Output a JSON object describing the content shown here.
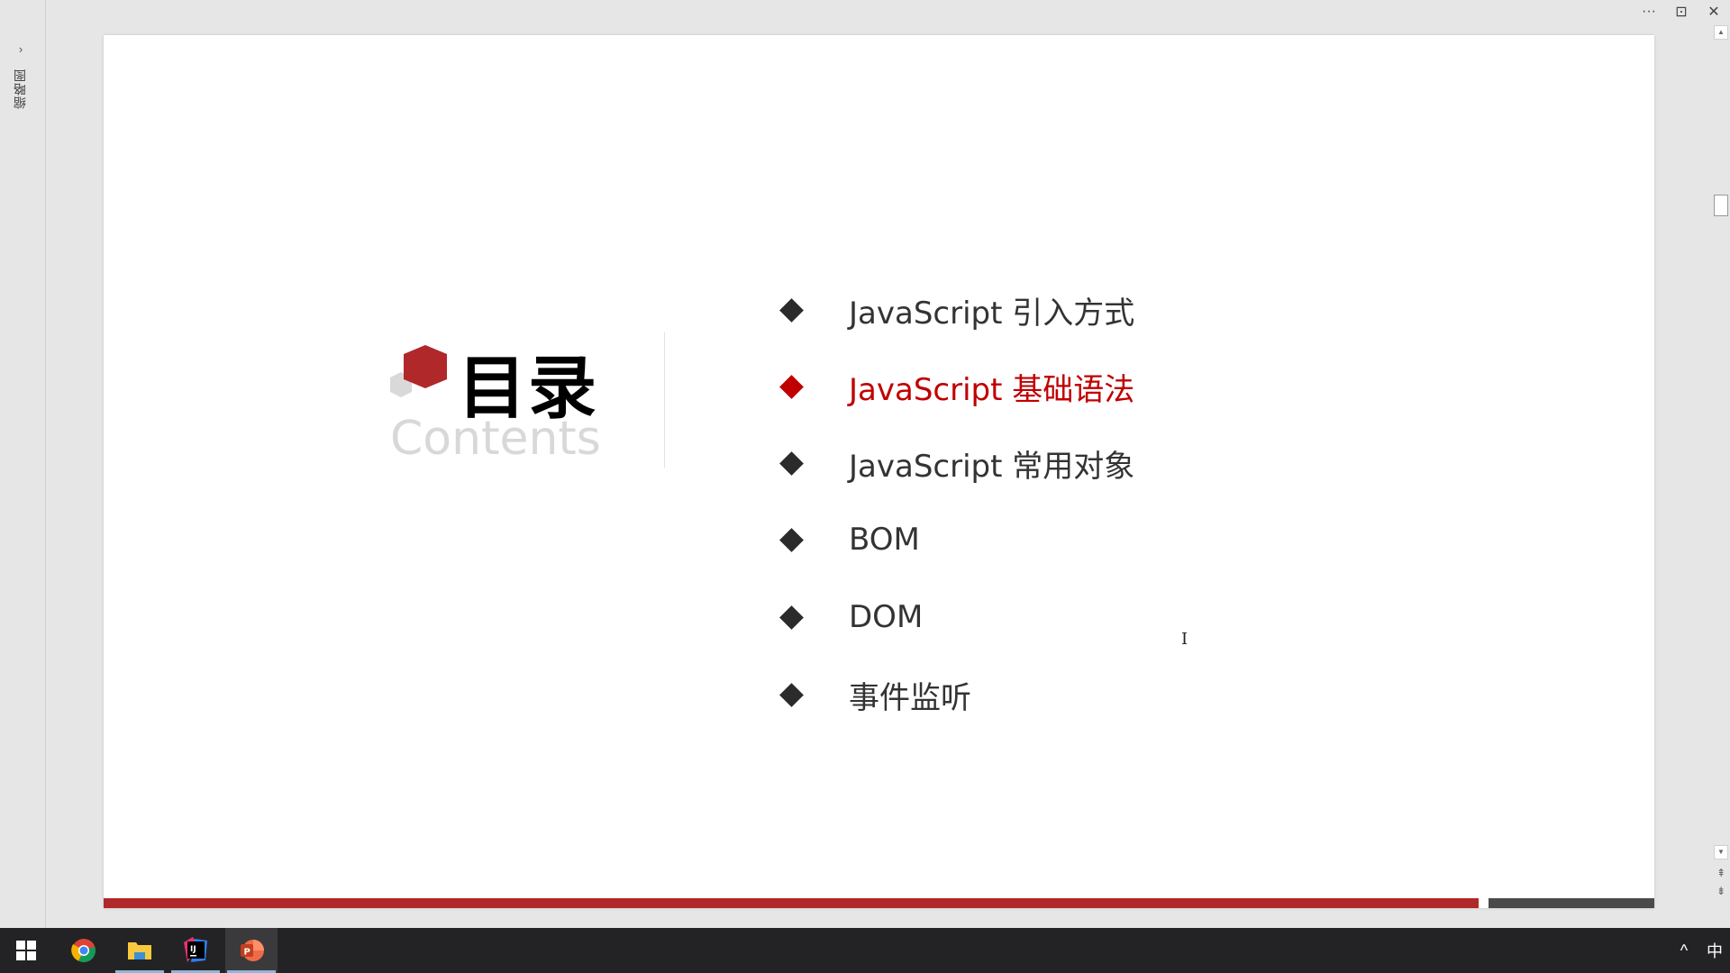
{
  "left_panel": {
    "expand_glyph": "›",
    "thumbnail_label": "缩略图"
  },
  "window_controls": {
    "more": "···",
    "restore": "⊡",
    "close": "✕"
  },
  "slide": {
    "title_cn": "目录",
    "title_en": "Contents",
    "items": [
      {
        "label": "JavaScript 引入方式",
        "active": false
      },
      {
        "label": "JavaScript 基础语法",
        "active": true
      },
      {
        "label": "JavaScript 常用对象",
        "active": false
      },
      {
        "label": "BOM",
        "active": false
      },
      {
        "label": "DOM",
        "active": false
      },
      {
        "label": "事件监听",
        "active": false
      }
    ],
    "colors": {
      "accent": "#c00000",
      "bar_red": "#b0282a",
      "bar_gray": "#4a4a4a",
      "hex_red": "#b0282a",
      "hex_gray": "#d9d9d9"
    }
  },
  "cursor_glyph": "I",
  "scrollbar": {
    "up": "▲",
    "down": "▼",
    "prev_slide": "⇞",
    "next_slide": "⇟"
  },
  "taskbar": {
    "apps": [
      {
        "name": "Windows Start",
        "icon": "windows-icon"
      },
      {
        "name": "Google Chrome",
        "icon": "chrome-icon"
      },
      {
        "name": "File Explorer",
        "icon": "folder-icon"
      },
      {
        "name": "IntelliJ IDEA",
        "icon": "intellij-icon",
        "label": "IJ"
      },
      {
        "name": "PowerPoint",
        "icon": "powerpoint-icon",
        "label": "P"
      }
    ],
    "tray_chevron": "^",
    "ime": "中"
  }
}
